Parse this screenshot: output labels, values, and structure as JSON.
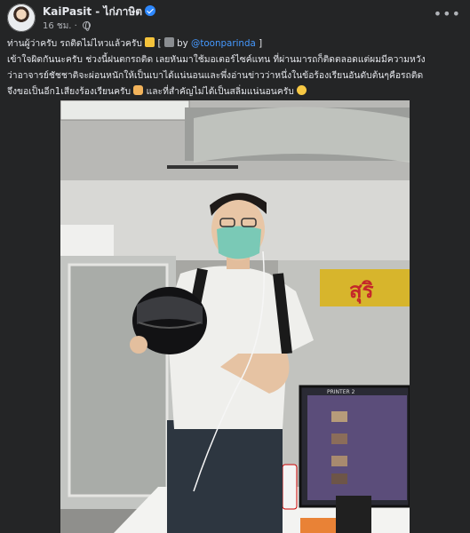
{
  "post": {
    "author": "KaiPasit - ไก่ภาษิต",
    "time": "16 ชม.",
    "more_icon": "more-horizontal-icon",
    "verified_icon": "verified-badge-icon",
    "audience_icon": "globe-icon",
    "caption": {
      "line1_text": "ท่านผู้ว่าครับ รถติดไม่ไหวแล้วครับ",
      "line1_bracket_open": " [ ",
      "line1_by": " by ",
      "line1_link": "@toonparinda",
      "line1_bracket_close": " ]",
      "line2": "เข้าใจผิดกันนะครับ ช่วงนี้ฝนตกรถติด เลยหันมาใช้มอเตอร์ไซค์แทน ที่ผ่านมารถก็ติดตลอดแต่ผมมีความหวัง",
      "line3": "ว่าอาจารย์ชัชชาติจะผ่อนหนักให้เป็นเบาได้แน่นอนและพึ่งอ่านข่าวว่าหนึ่งในข้อร้องเรียนอันดับต้นๆคือรถติด",
      "line4a": "จึงขอเป็นอีก1เสียงร้องเรียนครับ",
      "line4b": " และที่สำคัญไม่ได้เป็นสลิ่มแน่นอนครับ"
    },
    "photo": {
      "alt_subject": "man-holding-helmet-photo",
      "sign_text": "สุริ",
      "monitor_label": "PRINTER 2"
    }
  }
}
